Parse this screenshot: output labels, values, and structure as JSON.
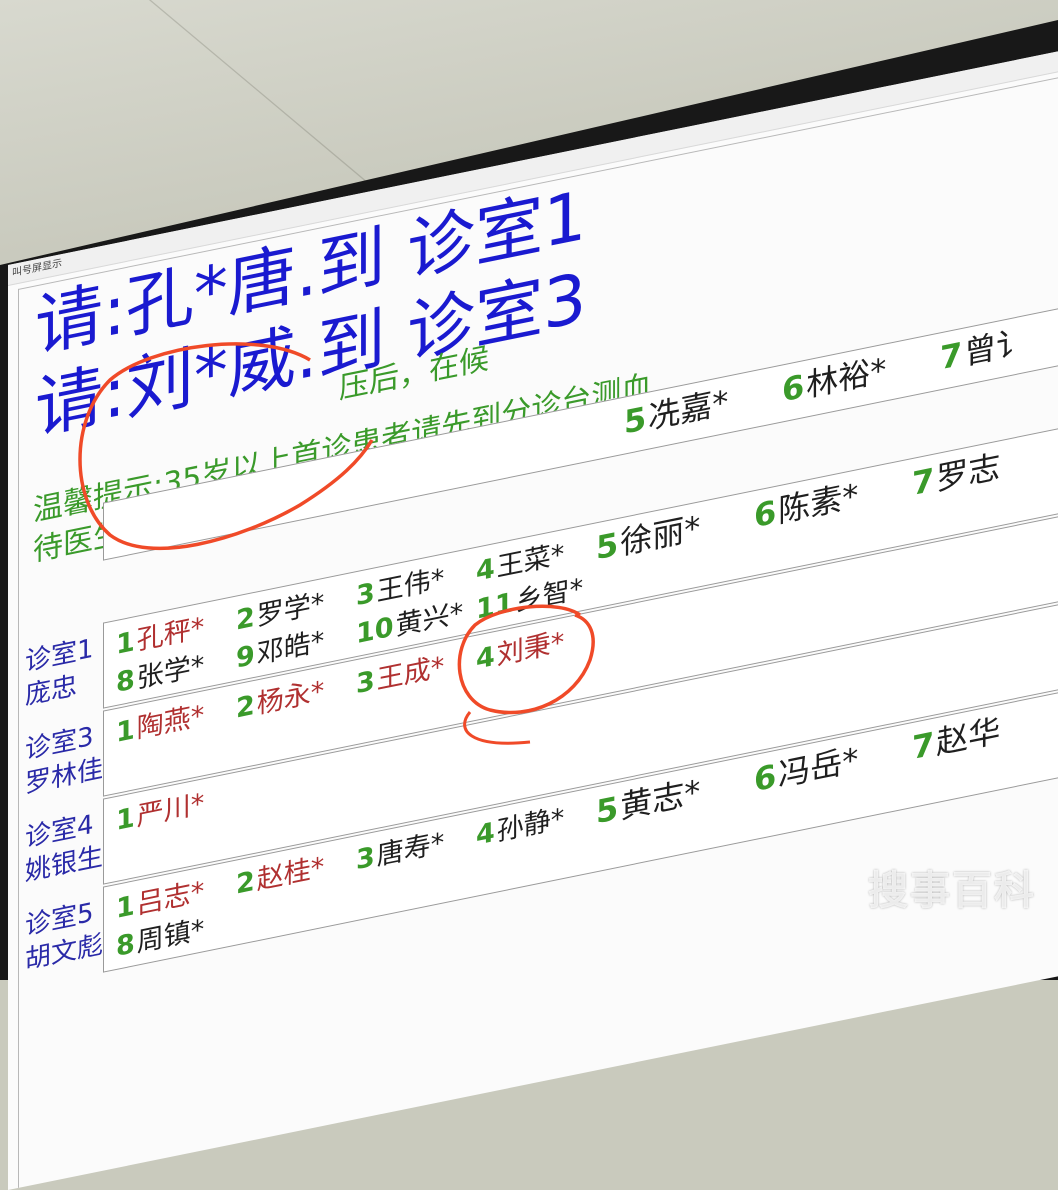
{
  "window": {
    "title": "叫号屏显示"
  },
  "calls": [
    {
      "text": "请:孔*唐.到 诊室1"
    },
    {
      "text": "请:刘*威.到 诊室3"
    }
  ],
  "tip": {
    "line1": "压后，在候",
    "line1_pre": "35岁以上首诊患者请先到分诊台测血",
    "label": "温馨提示:",
    "line3": "待医生叫号后进入诊室。谢谢！"
  },
  "upcoming_row": [
    {
      "num": "5",
      "name": "冼嘉*"
    },
    {
      "num": "6",
      "name": "林裕*"
    },
    {
      "num": "7",
      "name": "曾讠"
    }
  ],
  "rooms": [
    {
      "room": "诊室1",
      "doctor": "庞忠",
      "patients": [
        {
          "num": "1",
          "name": "孔秤*",
          "color": "red"
        },
        {
          "num": "2",
          "name": "罗学*",
          "color": "blk"
        },
        {
          "num": "3",
          "name": "王伟*",
          "color": "blk"
        },
        {
          "num": "4",
          "name": "王菜*",
          "color": "blk"
        },
        {
          "num": "5",
          "name": "徐丽*",
          "color": "blk"
        },
        {
          "num": "6",
          "name": "陈素*",
          "color": "blk"
        },
        {
          "num": "7",
          "name": "罗志",
          "color": "blk"
        },
        {
          "num": "8",
          "name": "张学*",
          "color": "blk"
        },
        {
          "num": "9",
          "name": "邓皓*",
          "color": "blk"
        },
        {
          "num": "10",
          "name": "黄兴*",
          "color": "blk"
        },
        {
          "num": "11",
          "name": "乡智*",
          "color": "blk"
        }
      ]
    },
    {
      "room": "诊室3",
      "doctor": "罗林佳",
      "patients": [
        {
          "num": "1",
          "name": "陶燕*",
          "color": "red"
        },
        {
          "num": "2",
          "name": "杨永*",
          "color": "red"
        },
        {
          "num": "3",
          "name": "王成*",
          "color": "red"
        },
        {
          "num": "4",
          "name": "刘秉*",
          "color": "red"
        }
      ]
    },
    {
      "room": "诊室4",
      "doctor": "姚银生",
      "patients": [
        {
          "num": "1",
          "name": "严川*",
          "color": "red"
        }
      ]
    },
    {
      "room": "诊室5",
      "doctor": "胡文彪",
      "patients": [
        {
          "num": "1",
          "name": "吕志*",
          "color": "red"
        },
        {
          "num": "2",
          "name": "赵桂*",
          "color": "red"
        },
        {
          "num": "3",
          "name": "唐寿*",
          "color": "blk"
        },
        {
          "num": "4",
          "name": "孙静*",
          "color": "blk"
        },
        {
          "num": "5",
          "name": "黄志*",
          "color": "blk"
        },
        {
          "num": "6",
          "name": "冯岳*",
          "color": "blk"
        },
        {
          "num": "7",
          "name": "赵华",
          "color": "blk"
        },
        {
          "num": "8",
          "name": "周镇*",
          "color": "blk"
        }
      ]
    }
  ],
  "watermark": "搜事百科",
  "colors": {
    "call": "#1a1ad0",
    "tip": "#3a9a2a",
    "called": "#b03030",
    "annotation": "#f04a28"
  }
}
